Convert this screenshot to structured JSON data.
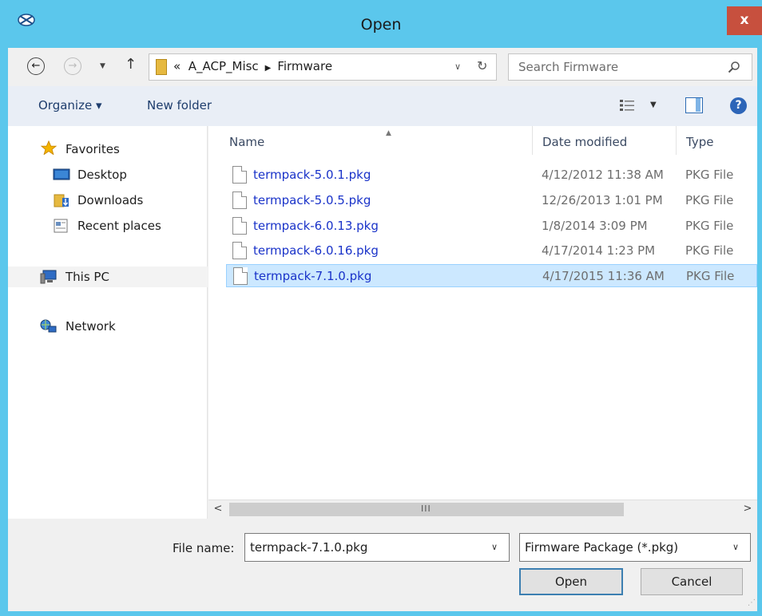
{
  "window": {
    "title": "Open",
    "close_label": "x"
  },
  "navigation": {
    "back_icon": "back-arrow-icon",
    "forward_icon": "forward-arrow-icon",
    "up_icon": "up-arrow-icon",
    "breadcrumb_prefix": "«",
    "breadcrumb": [
      "A_ACP_Misc",
      "Firmware"
    ],
    "search_placeholder": "Search Firmware"
  },
  "toolbar": {
    "organize_label": "Organize ▾",
    "new_folder_label": "New folder",
    "help_label": "?"
  },
  "sidebar": {
    "favorites": "Favorites",
    "items": [
      "Desktop",
      "Downloads",
      "Recent places"
    ],
    "this_pc": "This PC",
    "network": "Network"
  },
  "file_list": {
    "columns": [
      "Name",
      "Date modified",
      "Type"
    ],
    "files": [
      {
        "name": "termpack-5.0.1.pkg",
        "date": "4/12/2012 11:38 AM",
        "type": "PKG File"
      },
      {
        "name": "termpack-5.0.5.pkg",
        "date": "12/26/2013 1:01 PM",
        "type": "PKG File"
      },
      {
        "name": "termpack-6.0.13.pkg",
        "date": "1/8/2014 3:09 PM",
        "type": "PKG File"
      },
      {
        "name": "termpack-6.0.16.pkg",
        "date": "4/17/2014 1:23 PM",
        "type": "PKG File"
      },
      {
        "name": "termpack-7.1.0.pkg",
        "date": "4/17/2015 11:36 AM",
        "type": "PKG File"
      }
    ],
    "selected_index": 4
  },
  "scrollbar": {
    "left_arrow": "<",
    "right_arrow": ">",
    "grip": "III"
  },
  "footer": {
    "file_name_label": "File name:",
    "file_name_value": "termpack-7.1.0.pkg",
    "file_type_value": "Firmware Package (*.pkg)",
    "open_label": "Open",
    "cancel_label": "Cancel"
  },
  "colors": {
    "titlebar": "#5bc7ec",
    "close_button": "#c7503e",
    "link_text": "#1a33c9",
    "selection": "#cce8ff"
  }
}
